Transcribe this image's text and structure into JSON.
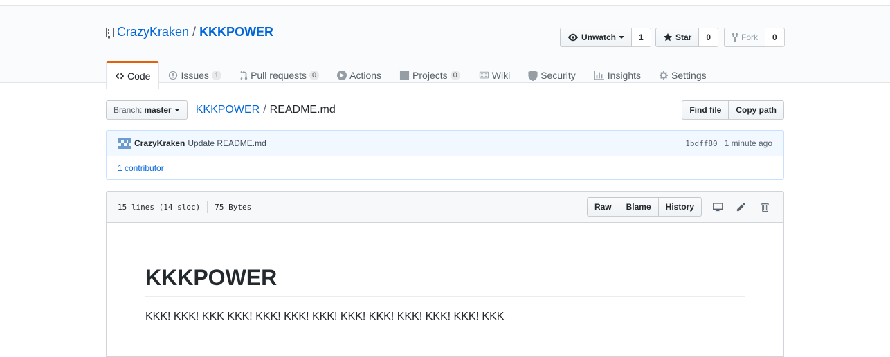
{
  "repo": {
    "owner": "CrazyKraken",
    "separator": "/",
    "name": "KKKPOWER"
  },
  "actions": {
    "watch": {
      "label": "Unwatch",
      "count": "1"
    },
    "star": {
      "label": "Star",
      "count": "0"
    },
    "fork": {
      "label": "Fork",
      "count": "0"
    }
  },
  "tabs": [
    {
      "label": "Code",
      "icon": "code-icon",
      "selected": true
    },
    {
      "label": "Issues",
      "icon": "issue-icon",
      "count": "1"
    },
    {
      "label": "Pull requests",
      "icon": "pull-request-icon",
      "count": "0"
    },
    {
      "label": "Actions",
      "icon": "play-icon"
    },
    {
      "label": "Projects",
      "icon": "project-icon",
      "count": "0"
    },
    {
      "label": "Wiki",
      "icon": "book-icon"
    },
    {
      "label": "Security",
      "icon": "shield-icon"
    },
    {
      "label": "Insights",
      "icon": "graph-icon"
    },
    {
      "label": "Settings",
      "icon": "gear-icon"
    }
  ],
  "filenav": {
    "branch_prefix": "Branch:",
    "branch": "master",
    "breadcrumb_repo": "KKKPOWER",
    "breadcrumb_sep": "/",
    "breadcrumb_file": "README.md",
    "find_file": "Find file",
    "copy_path": "Copy path"
  },
  "commit": {
    "author": "CrazyKraken",
    "message": "Update README.md",
    "sha": "1bdff80",
    "time": "1 minute ago",
    "contributors": "1 contributor"
  },
  "file": {
    "lines": "15 lines (14 sloc)",
    "size": "75 Bytes",
    "raw": "Raw",
    "blame": "Blame",
    "history": "History"
  },
  "readme": {
    "heading": "KKKPOWER",
    "body": "KKK! KKK! KKK KKK! KKK! KKK! KKK! KKK! KKK! KKK! KKK! KKK! KKK"
  },
  "colors": {
    "link": "#0366d6",
    "selected_tab": "#e36209"
  }
}
